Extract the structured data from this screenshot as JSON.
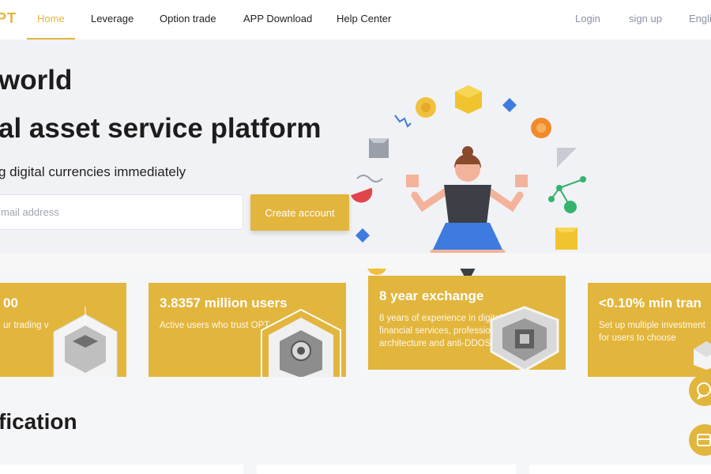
{
  "nav": {
    "logo": "PT",
    "items": [
      {
        "label": "Home",
        "active": true
      },
      {
        "label": "Leverage",
        "active": false
      },
      {
        "label": "Option trade",
        "active": false
      },
      {
        "label": "APP Download",
        "active": false
      },
      {
        "label": "Help Center",
        "active": false
      }
    ],
    "login": "Login",
    "signup": "sign up",
    "language": "Engli"
  },
  "hero": {
    "title_line1": "world",
    "title_line2": "al asset service platform",
    "subtitle": "g digital currencies immediately",
    "email_placeholder": "mail address",
    "create_button": "Create account"
  },
  "cards": [
    {
      "title": "00",
      "desc": "ur trading v"
    },
    {
      "title": "3.8357 million users",
      "desc": "Active users who trust OPT"
    },
    {
      "title": "8 year exchange",
      "desc": "8 years of experience in digital asset financial services, professional distributed architecture and anti-DDOS attack system"
    },
    {
      "title": "<0.10% min tran",
      "desc": "Set up multiple investment for users to choose"
    }
  ],
  "section": {
    "title": "fication"
  },
  "colors": {
    "accent": "#e2b53d",
    "nav_muted": "#8a93a5",
    "hero_bg": "#f1f2f5"
  },
  "icons": {
    "chat": "chat-icon",
    "app": "app-download-icon"
  }
}
